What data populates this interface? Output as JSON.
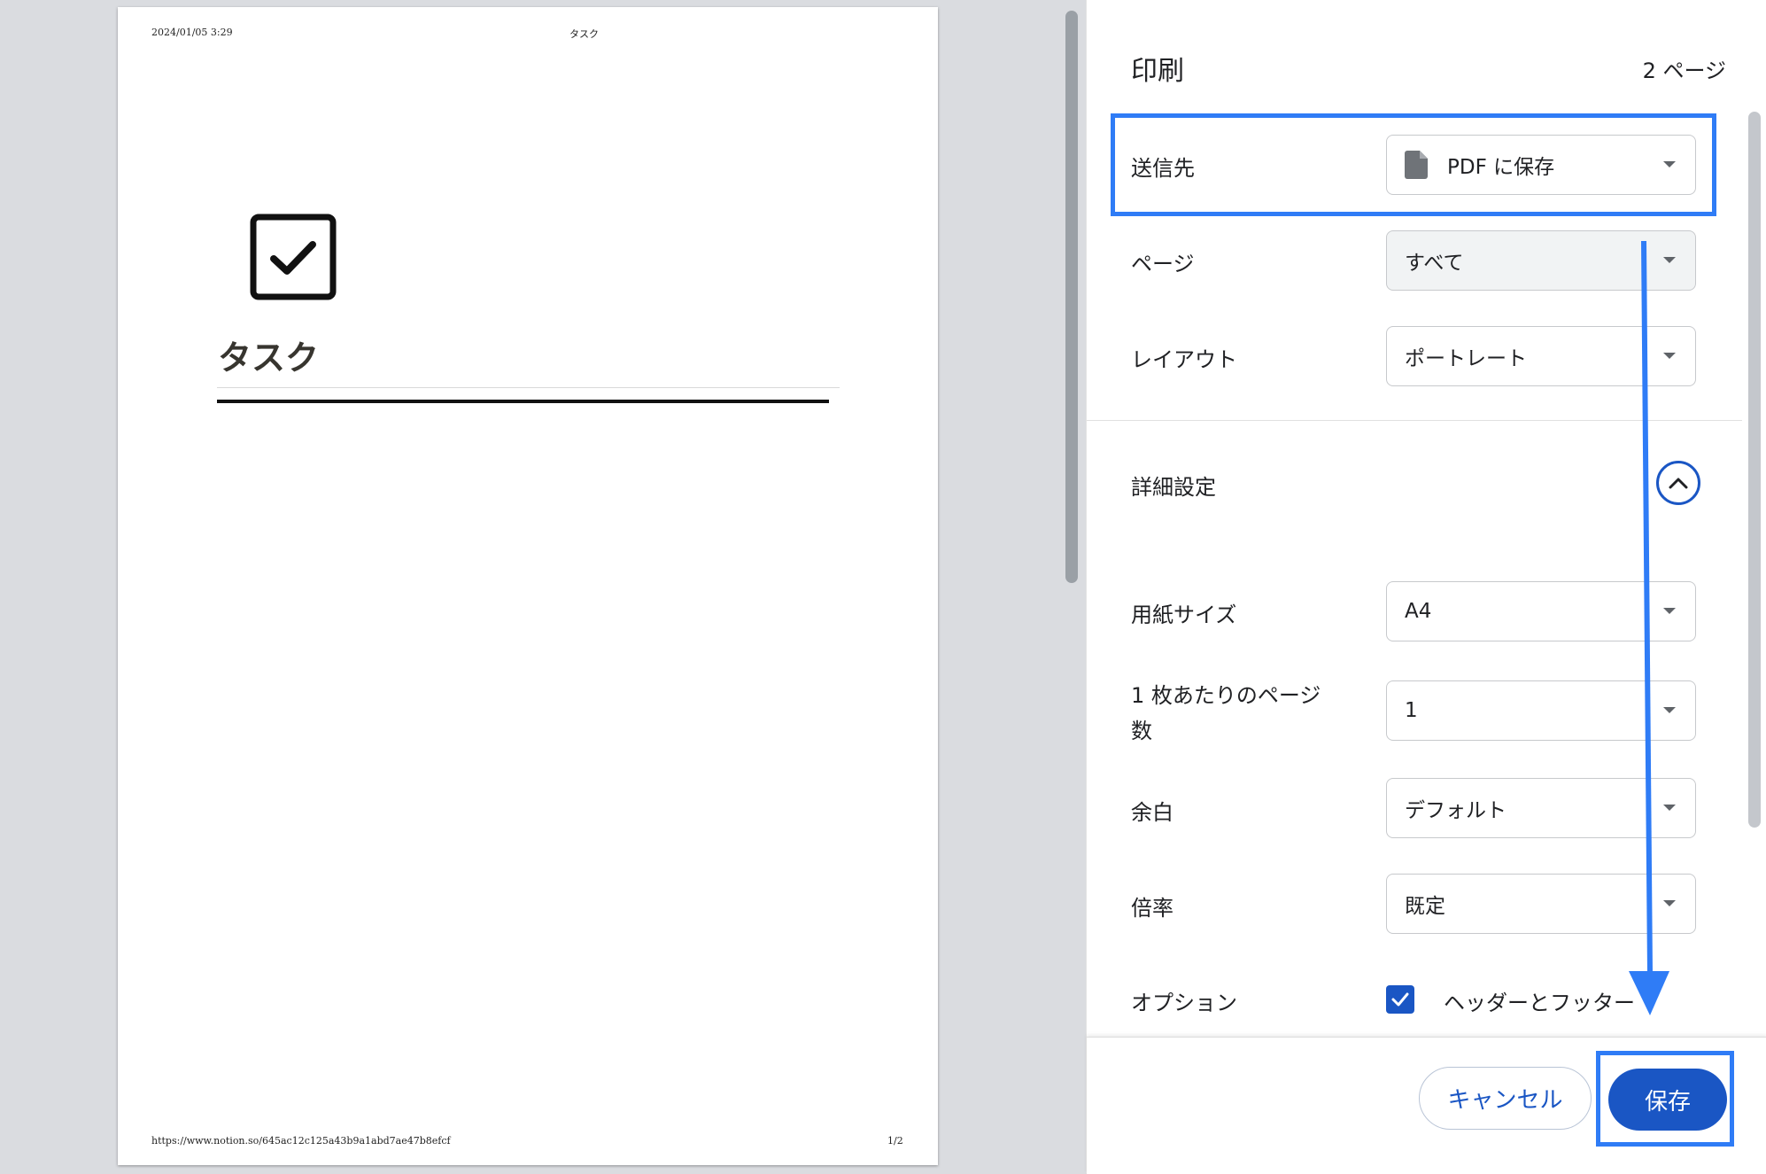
{
  "preview": {
    "header_date": "2024/01/05 3:29",
    "header_title": "タスク",
    "doc_title": "タスク",
    "footer_url": "https://www.notion.so/645ac12c125a43b9a1abd7ae47b8efcf",
    "footer_page": "1/2"
  },
  "panel": {
    "title": "印刷",
    "page_count": "2 ページ",
    "destination": {
      "label": "送信先",
      "value": "PDF に保存",
      "icon": "file-icon"
    },
    "pages": {
      "label": "ページ",
      "value": "すべて"
    },
    "layout": {
      "label": "レイアウト",
      "value": "ポートレート"
    },
    "advanced": {
      "label": "詳細設定",
      "icon": "chevron-up-icon"
    },
    "paper_size": {
      "label": "用紙サイズ",
      "value": "A4"
    },
    "pages_per_sheet": {
      "label_line1": "1 枚あたりのページ",
      "label_line2": "数",
      "value": "1"
    },
    "margins": {
      "label": "余白",
      "value": "デフォルト"
    },
    "scale": {
      "label": "倍率",
      "value": "既定"
    },
    "options": {
      "label": "オプション",
      "checkbox_label": "ヘッダーとフッター",
      "checked": true
    },
    "cancel_label": "キャンセル",
    "save_label": "保存"
  },
  "colors": {
    "accent": "#1a56c4",
    "annotation": "#2f7cf6"
  }
}
